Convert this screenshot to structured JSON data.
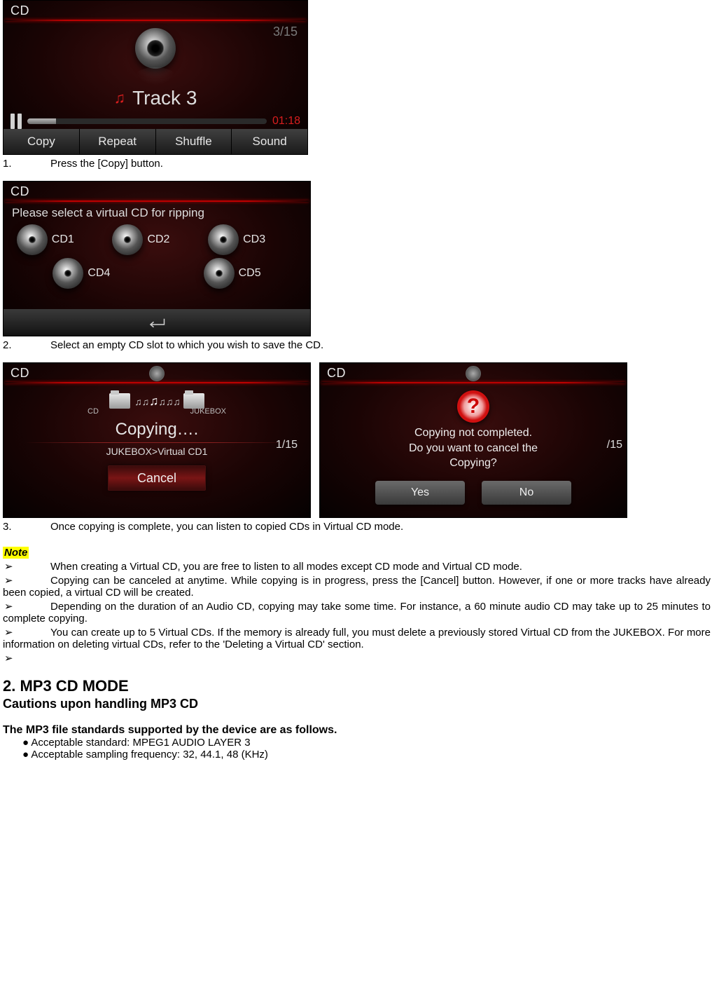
{
  "player": {
    "title": "CD",
    "track_count": "3/15",
    "track_name": "Track  3",
    "time": "01:18",
    "buttons": {
      "copy": "Copy",
      "repeat": "Repeat",
      "shuffle": "Shuffle",
      "sound": "Sound"
    }
  },
  "caption1_num": "1.",
  "caption1_text": "Press the [Copy] button.",
  "select": {
    "title": "CD",
    "prompt": "Please select a virtual CD for ripping",
    "slots": [
      "CD1",
      "CD2",
      "CD3",
      "CD4",
      "CD5"
    ]
  },
  "caption2_num": "2.",
  "caption2_text": "Select an empty CD slot to which you wish to save the CD.",
  "copying": {
    "title": "CD",
    "src_label": "CD",
    "dst_label": "JUKEBOX",
    "status": "Copying….",
    "progress": "1/15",
    "dest_path": "JUKEBOX>Virtual CD1",
    "cancel_label": "Cancel"
  },
  "confirm": {
    "title": "CD",
    "line1": "Copying not completed.",
    "line2": "Do you want to cancel the",
    "line3": "Copying?",
    "edge": "/15",
    "yes": "Yes",
    "no": "No"
  },
  "caption3_num": "3.",
  "caption3_text": "Once copying is complete, you can listen to copied CDs in Virtual CD mode.",
  "note_label": "Note",
  "note_items": [
    "When creating a Virtual CD, you are free to listen to all modes except CD mode and Virtual CD mode.",
    "Copying can be canceled at anytime. While copying is in progress, press the [Cancel] button. However, if one or more tracks have already been copied, a virtual CD will be created.",
    "Depending on the duration of an Audio CD, copying may take some time. For instance, a 60 minute audio CD may take up to 25 minutes to complete copying.",
    "You can create up to 5 Virtual CDs. If the memory is already full, you must delete a previously stored Virtual CD from the JUKEBOX. For more information on deleting virtual CDs, refer to the 'Deleting a Virtual CD' section.",
    ""
  ],
  "arrow": "➢",
  "mp3": {
    "heading": "2. MP3 CD MODE",
    "sub": "Cautions upon handling MP3 CD",
    "line": "The MP3 file standards supported by the device are as follows.",
    "b1": "● Acceptable standard: MPEG1 AUDIO LAYER 3",
    "b2": "● Acceptable sampling frequency: 32, 44.1, 48 (KHz)"
  }
}
